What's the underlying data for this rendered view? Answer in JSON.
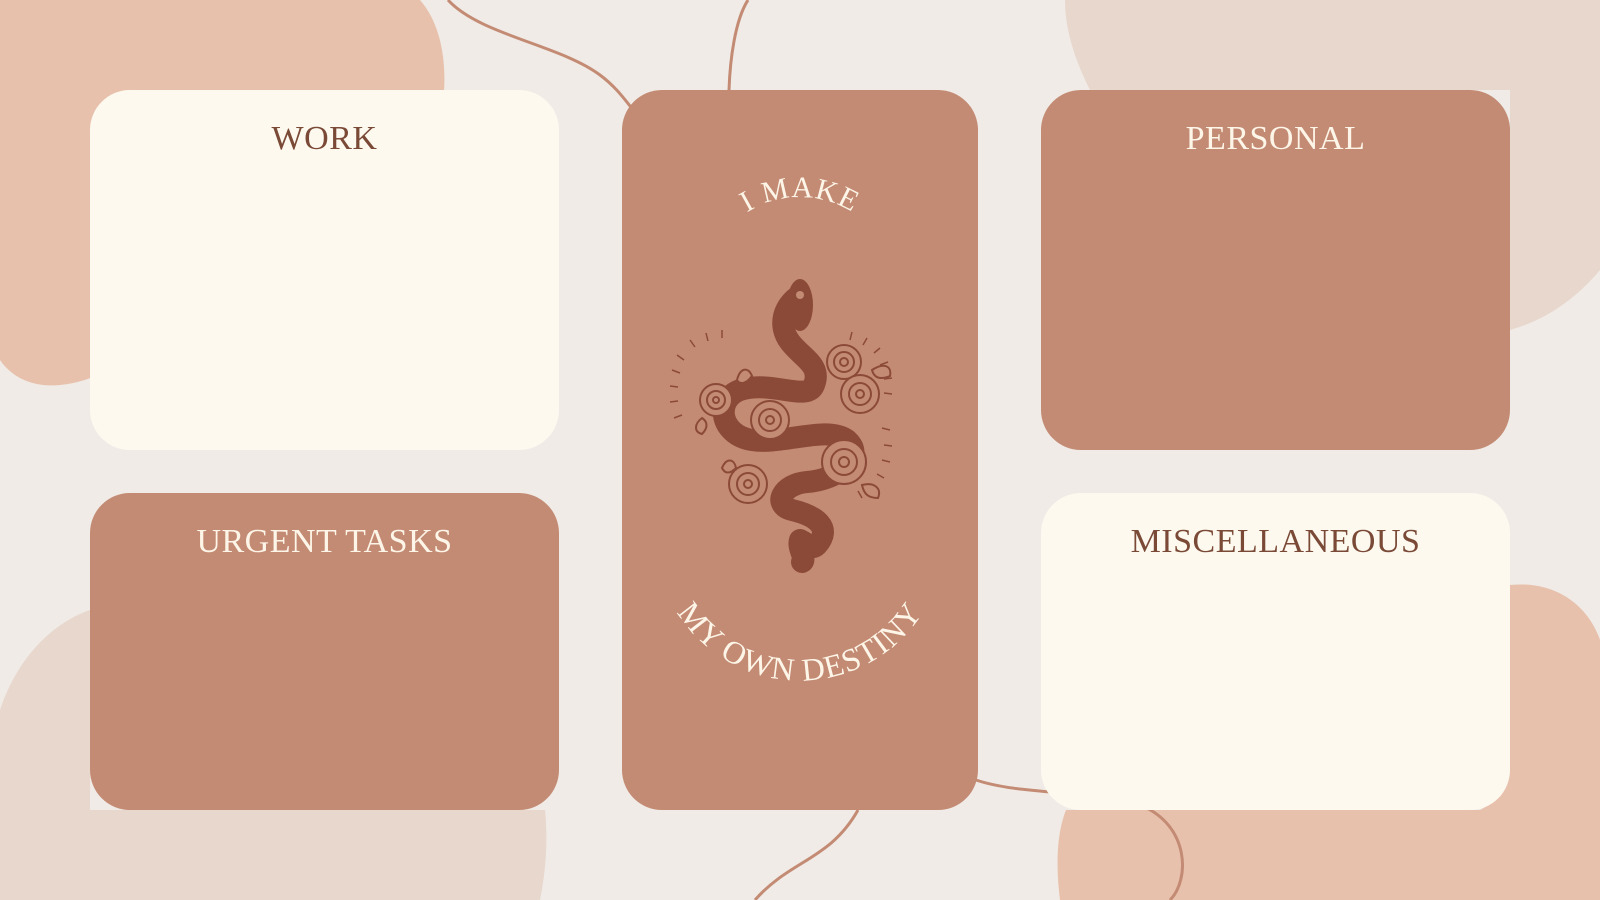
{
  "cards": {
    "work": {
      "title": "WORK"
    },
    "personal": {
      "title": "PERSONAL"
    },
    "urgent": {
      "title": "URGENT TASKS"
    },
    "misc": {
      "title": "MISCELLANEOUS"
    }
  },
  "affirmation": {
    "top": "I MAKE",
    "bottom": "MY OWN DESTINY"
  },
  "colors": {
    "background": "#f0ebe6",
    "card_light": "#fdf9ef",
    "card_terracotta": "#c48b74",
    "blob_pink": "#e8c1ad",
    "blob_beige": "#e8d7cd",
    "line": "#c48b74",
    "illustration": "#8b4a37"
  },
  "icons": {
    "illustration": "snake-with-roses-icon"
  }
}
